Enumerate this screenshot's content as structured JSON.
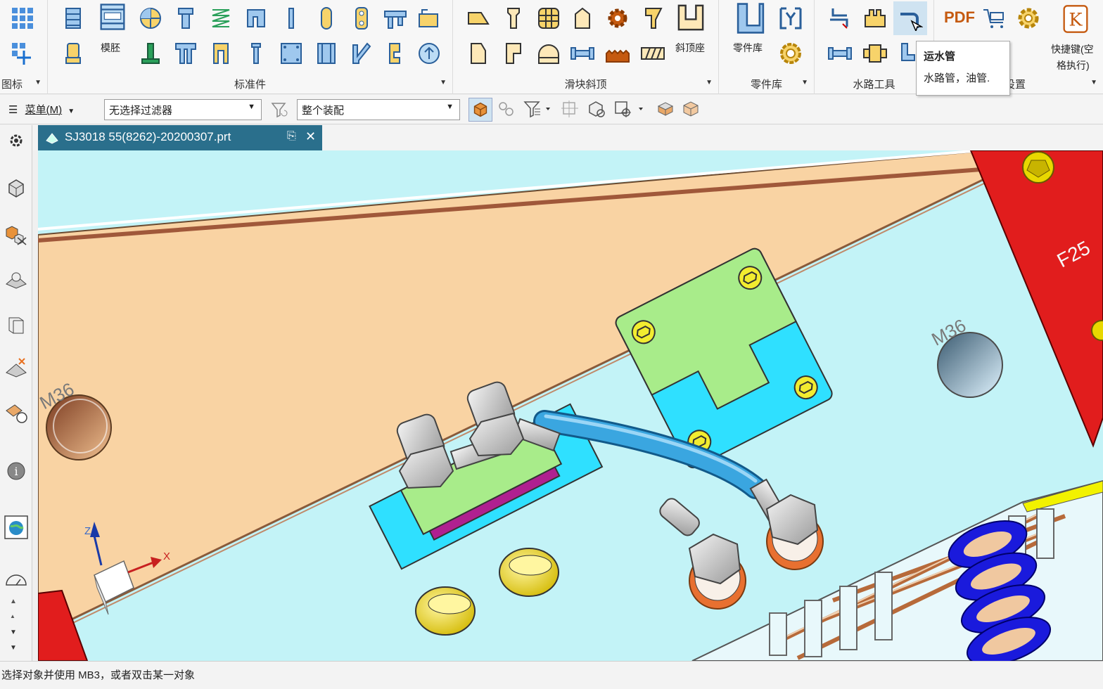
{
  "ribbon": {
    "groups": [
      {
        "name": "图标"
      },
      {
        "name": "标准件"
      },
      {
        "name": "滑块斜顶"
      },
      {
        "name": "零件库"
      },
      {
        "name": "水路工具"
      },
      {
        "name": "设置"
      }
    ],
    "labels": {
      "mold_base": "模胚",
      "lifter_seat": "斜顶座",
      "parts_lib": "零件库",
      "hotkey_line1": "快捷键(空",
      "hotkey_line2": "格执行)",
      "pdf": "PDF"
    }
  },
  "tooltip": {
    "title": "运水管",
    "desc": "水路管，油管."
  },
  "toolbar": {
    "menu_label": "菜单(M)",
    "filter_value": "无选择过滤器",
    "scope_value": "整个装配"
  },
  "tab": {
    "title": "SJ3018 55(8262)-20200307.prt"
  },
  "viewport": {
    "labels": {
      "m36_left": "M36",
      "m36_right": "M36",
      "f25": "F25"
    },
    "axes": {
      "z": "Z",
      "x": "X"
    }
  },
  "status": {
    "text": "选择对象并使用 MB3，或者双击某一对象"
  },
  "colors": {
    "plate": "#f9d3a3",
    "bottom": "#c3f3f7",
    "red": "#e11d1d",
    "hose": "#3aa6e0",
    "tab": "#2a6f8c"
  }
}
